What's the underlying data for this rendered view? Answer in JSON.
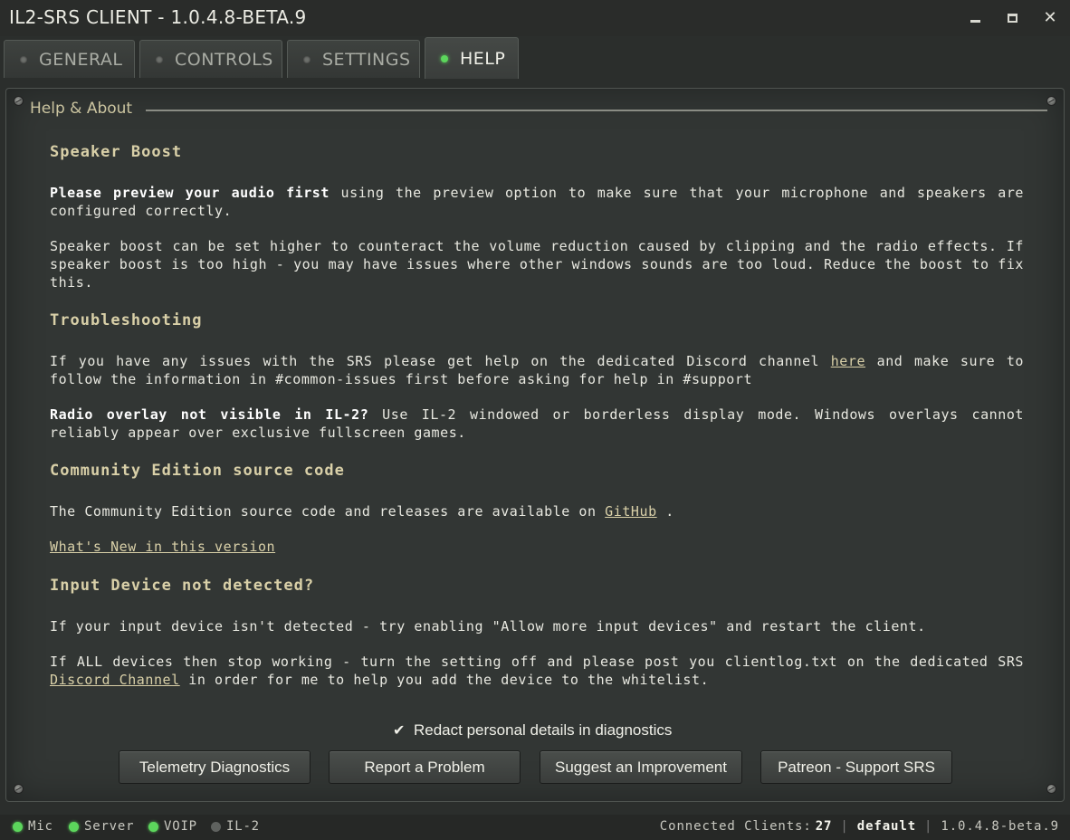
{
  "window": {
    "title": "IL2-SRS CLIENT - 1.0.4.8-BETA.9",
    "minimize": "",
    "maximize": "",
    "close": "✕"
  },
  "tabs": [
    {
      "label": "GENERAL",
      "active": false
    },
    {
      "label": "CONTROLS",
      "active": false
    },
    {
      "label": "SETTINGS",
      "active": false
    },
    {
      "label": "HELP",
      "active": true
    }
  ],
  "panel": {
    "title": "Help & About"
  },
  "help": {
    "speaker_boost_heading": "Speaker Boost",
    "preview_bold": "Please preview your audio first",
    "preview_text": " using the preview option to make sure that your microphone and speakers are configured correctly.",
    "boost_text": "Speaker boost can be set higher to counteract the volume reduction caused by clipping and the radio effects. If speaker boost is too high - you may have issues where other windows sounds are too loud. Reduce the boost to fix this.",
    "troubleshooting_heading": "Troubleshooting",
    "trouble_text_1": "If you have any issues with the SRS please get help on the dedicated Discord channel ",
    "trouble_link": "here",
    "trouble_text_2": " and make sure to follow the information in #common-issues first before asking for help in #support",
    "overlay_bold": "Radio overlay not visible in IL-2?",
    "overlay_text": " Use IL-2 windowed or borderless display mode. Windows overlays cannot reliably appear over exclusive fullscreen games.",
    "community_heading": "Community Edition source code",
    "community_text_1": "The Community Edition source code and releases are available on ",
    "community_link": "GitHub",
    "community_text_2": " .",
    "whats_new_link": "What's New in this version",
    "input_heading": "Input Device not detected?",
    "input_text": "If your input device isn't detected - try enabling \"Allow more input devices\" and restart the client.",
    "all_devices_text_1": "If ALL devices then stop working - turn the setting off and please post you clientlog.txt on the dedicated SRS ",
    "discord_channel_link": "Discord Channel",
    "all_devices_text_2": " in order for me to help you add the device to the whitelist."
  },
  "redact": {
    "checked": true,
    "check_mark": "✔",
    "label": "Redact personal details in diagnostics"
  },
  "buttons": {
    "telemetry": "Telemetry Diagnostics",
    "report": "Report a Problem",
    "suggest": "Suggest an Improvement",
    "patreon": "Patreon - Support SRS"
  },
  "status": {
    "mic": {
      "label": "Mic",
      "on": true
    },
    "server": {
      "label": "Server",
      "on": true
    },
    "voip": {
      "label": "VOIP",
      "on": true
    },
    "il2": {
      "label": "IL-2",
      "on": false
    },
    "clients_label": "Connected Clients:",
    "clients_count": "27",
    "separator": "|",
    "profile": "default",
    "version": "1.0.4.8-beta.9"
  },
  "colors": {
    "accent_heading": "#d9d0a8",
    "led_on": "#5cd65c",
    "led_off": "#5f625f",
    "background": "#2b2e2c"
  }
}
